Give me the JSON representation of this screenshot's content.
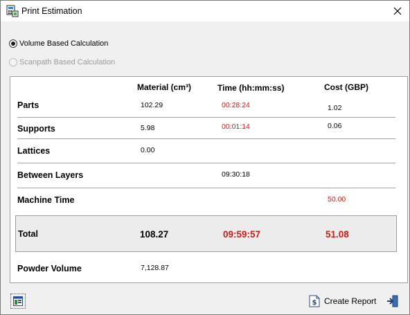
{
  "window": {
    "title": "Print Estimation"
  },
  "calculation_mode": {
    "options": [
      {
        "label": "Volume Based Calculation",
        "selected": true,
        "enabled": true
      },
      {
        "label": "Scanpath Based Calculation",
        "selected": false,
        "enabled": false
      }
    ]
  },
  "table": {
    "headers": {
      "material": "Material (cm³)",
      "time": "Time (hh:mm:ss)",
      "cost": "Cost  (GBP)"
    },
    "rows": [
      {
        "label": "Parts",
        "material": "102.29",
        "time": "00:28:24",
        "cost": "1.02"
      },
      {
        "label": "Supports",
        "material": "5.98",
        "time": "00:01:14",
        "cost": "0.06"
      },
      {
        "label": "Lattices",
        "material": "0.00",
        "time": "",
        "cost": ""
      },
      {
        "label": "Between Layers",
        "material": "",
        "time": "09:30:18",
        "cost": ""
      },
      {
        "label": "Machine Time",
        "material": "",
        "time": "",
        "cost": "50.00"
      }
    ],
    "total": {
      "label": "Total",
      "material": "108.27",
      "time": "09:59:57",
      "cost": "51.08"
    },
    "powder": {
      "label": "Powder Volume",
      "value": "7,128.87"
    }
  },
  "footer": {
    "create_report_label": "Create Report"
  },
  "colors": {
    "highlight_red": "#d11a1a"
  },
  "icons": {
    "title": "calculator-printer-icon",
    "close": "close-icon",
    "settings": "window-settings-icon",
    "report": "dollar-document-icon",
    "exit": "exit-door-icon"
  }
}
